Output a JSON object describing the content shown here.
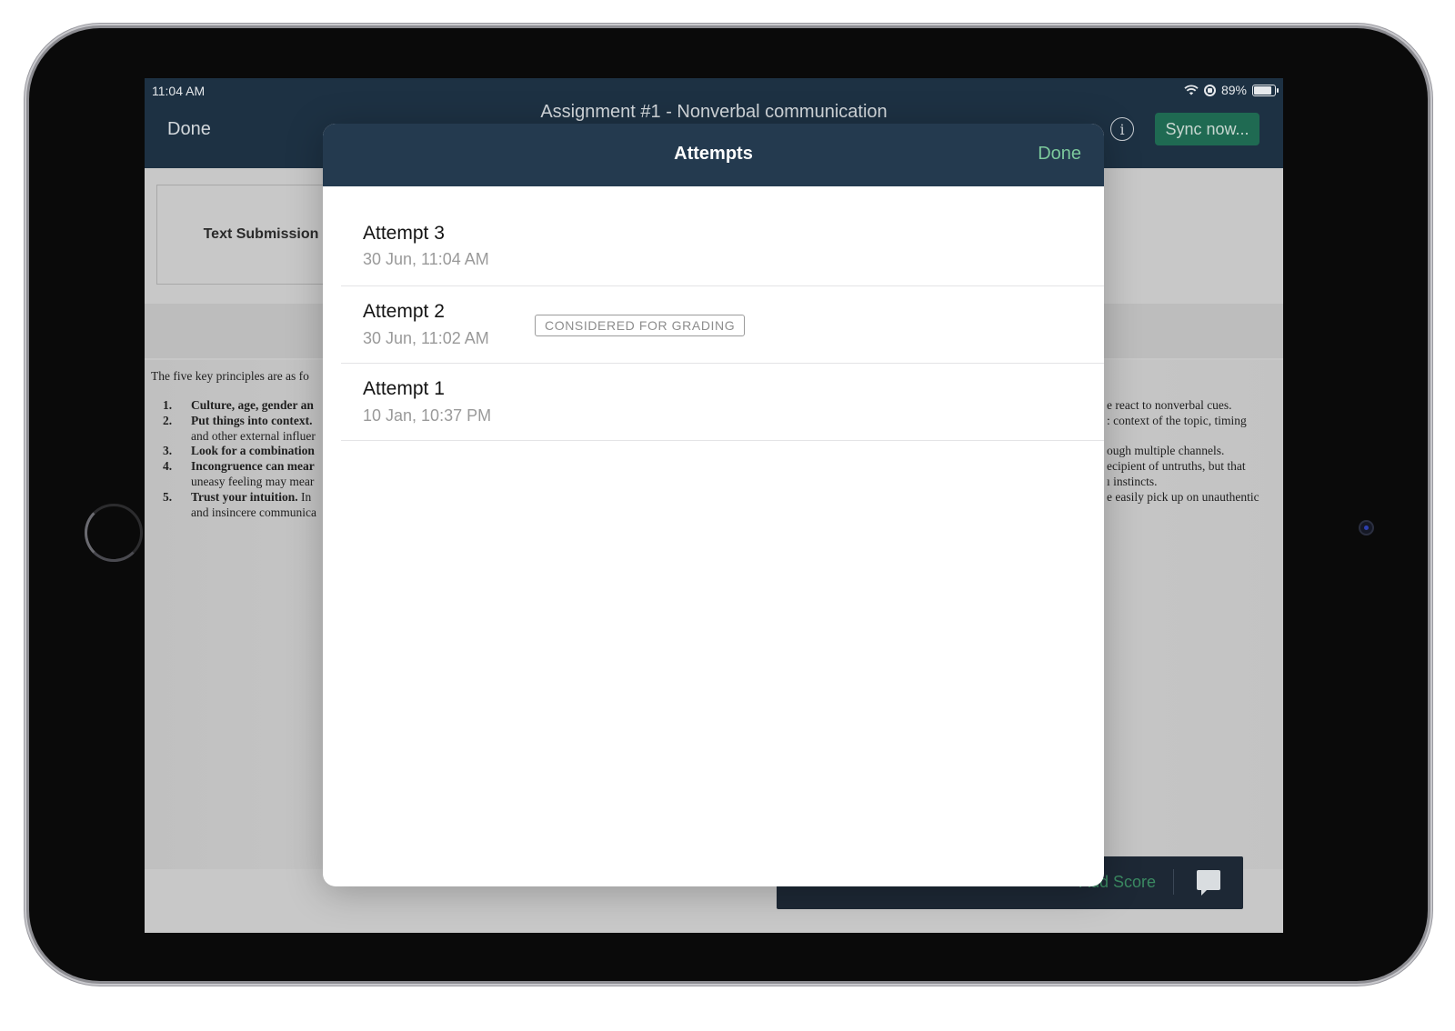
{
  "status_bar": {
    "time": "11:04 AM",
    "battery": "89%",
    "battery_level": 0.89
  },
  "nav": {
    "done_label": "Done",
    "title": "Assignment #1 - Nonverbal communication",
    "info_glyph": "i",
    "sync_label": "Sync now..."
  },
  "submission": {
    "label": "Text Submission"
  },
  "document": {
    "intro": "The five key principles are as fo",
    "items_left": [
      {
        "num": "1.",
        "bold": "Culture, age, gender an",
        "rest": ""
      },
      {
        "num": "2.",
        "bold": "Put things into context.",
        "rest": ""
      },
      {
        "num": "",
        "bold": "",
        "rest": "and other external influer"
      },
      {
        "num": "3.",
        "bold": "Look for a combination",
        "rest": ""
      },
      {
        "num": "4.",
        "bold": "Incongruence can mear",
        "rest": ""
      },
      {
        "num": "",
        "bold": "",
        "rest": "uneasy feeling may mear"
      },
      {
        "num": "5.",
        "bold": "Trust your intuition.",
        "rest": " In"
      },
      {
        "num": "",
        "bold": "",
        "rest": "and insincere communica"
      }
    ],
    "items_right": [
      "e react to nonverbal cues.",
      ": context of the topic, timing",
      "",
      "ough multiple channels.",
      "ecipient of untruths, but that",
      "ı instincts.",
      "e easily pick up on unauthentic",
      ""
    ]
  },
  "toolbar": {
    "add_score_label": "Add Score",
    "comment_icon": "comment-icon"
  },
  "modal": {
    "title": "Attempts",
    "done_label": "Done",
    "attempts": [
      {
        "name": "Attempt 3",
        "date": "30 Jun, 11:04 AM",
        "badge": ""
      },
      {
        "name": "Attempt 2",
        "date": "30 Jun, 11:02 AM",
        "badge": "CONSIDERED FOR GRADING"
      },
      {
        "name": "Attempt 1",
        "date": "10 Jan, 10:37 PM",
        "badge": ""
      }
    ]
  },
  "colors": {
    "nav_bg": "#1d3143",
    "modal_header_bg": "#243a4f",
    "accent_green": "#7cc99c",
    "sync_bg": "#1f6a52"
  }
}
